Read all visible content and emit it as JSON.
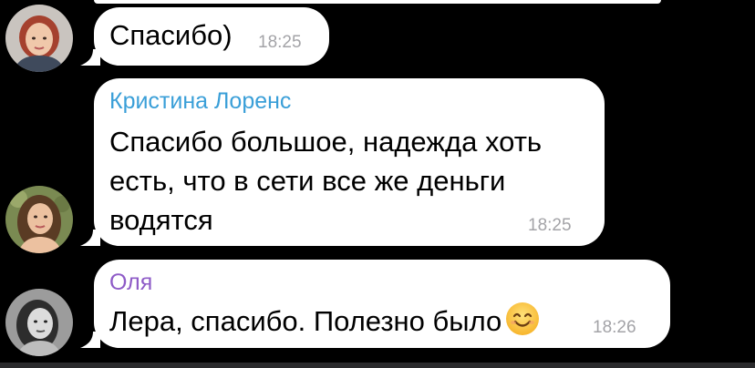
{
  "colors": {
    "background": "#000000",
    "bubble": "#ffffff",
    "sender_kristina": "#3a9fd8",
    "sender_olya": "#8e5bc7",
    "timestamp": "#a3a3a7"
  },
  "messages": [
    {
      "sender": "",
      "avatar": "woman-red-hair-avatar",
      "lines": [
        "Спасибо)"
      ],
      "time": "18:25"
    },
    {
      "sender": "Кристина Лоренс",
      "avatar": "woman-long-hair-avatar",
      "lines": [
        "Спасибо большое, надежда хоть",
        "есть, что в сети все же деньги",
        "водятся"
      ],
      "time": "18:25"
    },
    {
      "sender": "Оля",
      "avatar": "woman-monochrome-avatar",
      "lines": [
        "Лера, спасибо. Полезно было"
      ],
      "emoji": "smiling-face-emoji",
      "time": "18:26"
    }
  ]
}
